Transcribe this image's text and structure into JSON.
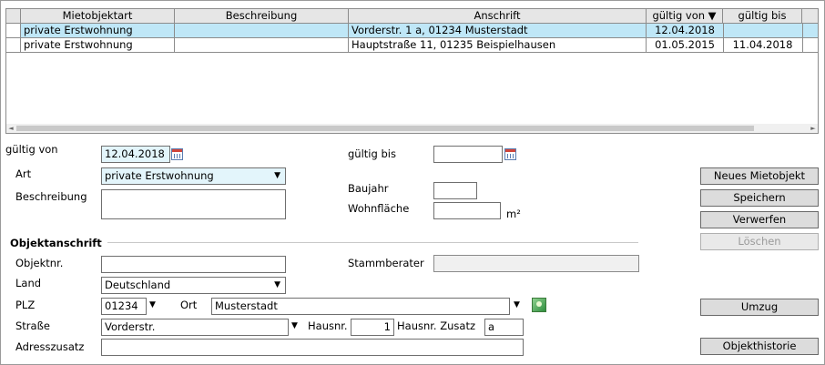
{
  "grid": {
    "columns": [
      "Mietobjektart",
      "Beschreibung",
      "Anschrift",
      "gültig von ▼",
      "gültig bis"
    ],
    "rows": [
      {
        "art": "private Erstwohnung",
        "beschreibung": "",
        "anschrift": "Vorderstr. 1 a, 01234 Musterstadt",
        "von": "12.04.2018",
        "bis": ""
      },
      {
        "art": "private Erstwohnung",
        "beschreibung": "",
        "anschrift": "Hauptstraße 11, 01235 Beispielhausen",
        "von": "01.05.2015",
        "bis": "11.04.2018"
      }
    ]
  },
  "form": {
    "gueltig_von_label": "gültig von",
    "gueltig_von_value": "12.04.2018",
    "gueltig_bis_label": "gültig bis",
    "gueltig_bis_value": "",
    "art_label": "Art",
    "art_value": "private Erstwohnung",
    "beschreibung_label": "Beschreibung",
    "beschreibung_value": "",
    "baujahr_label": "Baujahr",
    "baujahr_value": "",
    "wohnflaeche_label": "Wohnfläche",
    "wohnflaeche_value": "",
    "wohnflaeche_unit": "m²"
  },
  "address": {
    "section_title": "Objektanschrift",
    "objektnr_label": "Objektnr.",
    "objektnr_value": "",
    "stammberater_label": "Stammberater",
    "stammberater_value": "",
    "land_label": "Land",
    "land_value": "Deutschland",
    "plz_label": "PLZ",
    "plz_value": "01234",
    "ort_label": "Ort",
    "ort_value": "Musterstadt",
    "strasse_label": "Straße",
    "strasse_value": "Vorderstr.",
    "hausnr_label": "Hausnr.",
    "hausnr_value": "1",
    "zusatz_label": "Hausnr. Zusatz",
    "zusatz_value": "a",
    "adresszusatz_label": "Adresszusatz",
    "adresszusatz_value": ""
  },
  "buttons": {
    "neu": "Neues Mietobjekt",
    "speichern": "Speichern",
    "verwerfen": "Verwerfen",
    "loeschen": "Löschen",
    "umzug": "Umzug",
    "historie": "Objekthistorie"
  },
  "icons": {
    "dropdown": "▼",
    "scroll_left": "◄",
    "scroll_right": "►"
  }
}
